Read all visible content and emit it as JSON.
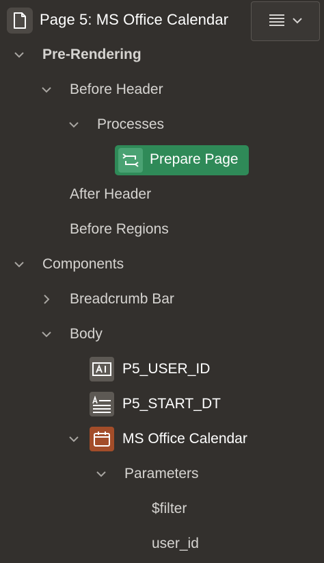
{
  "header": {
    "page_title": "Page 5: MS Office Calendar"
  },
  "tree": {
    "pre_rendering": "Pre-Rendering",
    "before_header": "Before Header",
    "processes": "Processes",
    "prepare_page": "Prepare Page",
    "after_header": "After Header",
    "before_regions": "Before Regions",
    "components": "Components",
    "breadcrumb_bar": "Breadcrumb Bar",
    "body": "Body",
    "p5_user_id": "P5_USER_ID",
    "p5_start_dt": "P5_START_DT",
    "ms_office_calendar": "MS Office Calendar",
    "parameters": "Parameters",
    "filter": "$filter",
    "user_id": "user_id"
  },
  "colors": {
    "background": "#33302d",
    "selected": "#2f8a58",
    "region_icon": "#a34d29"
  }
}
